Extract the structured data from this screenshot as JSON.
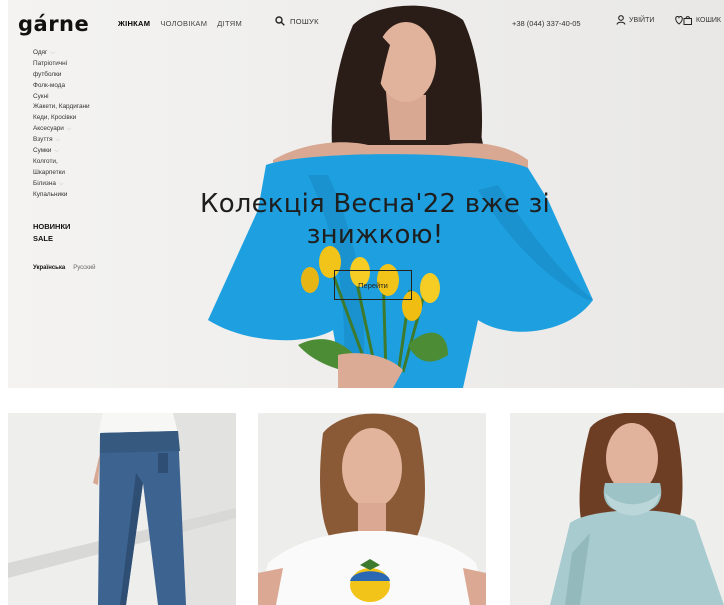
{
  "header": {
    "logo": "gárne",
    "nav": [
      "ЖІНКАМ",
      "ЧОЛОВІКАМ",
      "ДІТЯМ"
    ],
    "search_label": "ПОШУК",
    "phone": "+38 (044) 337-40-05",
    "login_label": "УВІЙТИ",
    "cart_label": "КОШИК"
  },
  "sidebar": {
    "categories": [
      "Одяг",
      "Патріотичні",
      "футболки",
      "Фолк-мода",
      "Сукні",
      "Жакети, Кардигани",
      "Кеди, Кросівки",
      "Аксесуари",
      "Взуття",
      "Сумки",
      "Колготи,",
      "Шкарпетки",
      "Білизна",
      "Купальники"
    ],
    "featured": [
      "НОВИНКИ",
      "SALE"
    ],
    "languages": [
      "Українська",
      "Русский"
    ]
  },
  "hero": {
    "title_line1": "Колекція Весна'22 вже зі",
    "title_line2": "знижкою!",
    "button_label": "Перейти"
  },
  "colors": {
    "dress_blue": "#1ea0e0",
    "tulip_yellow": "#f2c318",
    "background": "#f2f1ef"
  }
}
